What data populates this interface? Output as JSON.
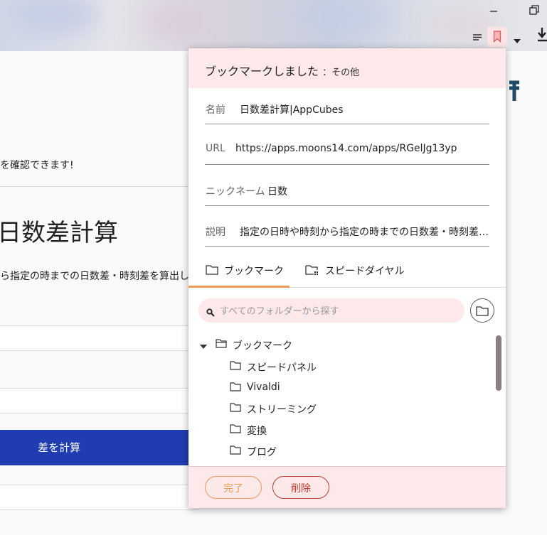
{
  "browser": {
    "window_controls": {
      "minimize_icon": "minimize-icon",
      "restore_icon": "restore-icon"
    },
    "toolbar_icons": [
      "reader-view-icon",
      "bookmark-icon",
      "dropdown-arrow-icon",
      "download-icon"
    ]
  },
  "page": {
    "confirm_text": "を確認できます!",
    "heading": "日数差計算",
    "description": "ら指定の時までの日数差・時刻差を算出し",
    "calc_button": "差を計算"
  },
  "popup": {
    "title": "ブックマークしました",
    "title_suffix": "：その他",
    "fields": {
      "name_label": "名前",
      "name_value": "日数差計算|AppCubes",
      "url_label": "URL",
      "url_value": "https://apps.moons14.com/apps/RGelJg13yp",
      "nickname_label": "ニックネーム",
      "nickname_value": "日数",
      "description_label": "説明",
      "description_value": "指定の日時や時刻から指定の時までの日数差・時刻差を算出します"
    },
    "tabs": {
      "bookmarks": "ブックマーク",
      "speed_dial": "スピードダイヤル"
    },
    "search": {
      "placeholder": "すべてのフォルダーから探す"
    },
    "tree": {
      "root": "ブックマーク",
      "children": [
        "スピードパネル",
        "Vivaldi",
        "ストリーミング",
        "変換",
        "ブログ"
      ]
    },
    "footer": {
      "done": "完了",
      "delete": "削除"
    }
  },
  "colors": {
    "accent_pink": "#fde9e9",
    "done_orange": "#f29a55",
    "delete_red": "#c0392b",
    "calc_blue": "#1f3cb0"
  }
}
